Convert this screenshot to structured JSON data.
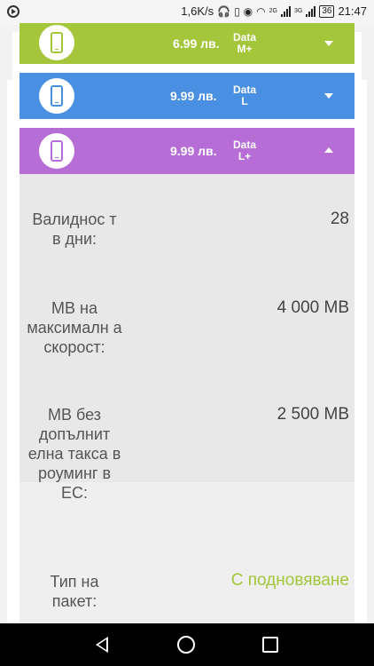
{
  "status_bar": {
    "speed": "1,6K/s",
    "net_1": "2G",
    "net_2": "3G",
    "battery": "36",
    "time": "21:47"
  },
  "cards": [
    {
      "price": "6.99 лв.",
      "plan_line1": "Data",
      "plan_line2": "M+",
      "color": "#a3c63a",
      "state": "collapsed"
    },
    {
      "price": "9.99 лв.",
      "plan_line1": "Data",
      "plan_line2": "L",
      "color": "#4a90e2",
      "state": "collapsed"
    },
    {
      "price": "9.99 лв.",
      "plan_line1": "Data",
      "plan_line2": "L+",
      "color": "#b66dd6",
      "state": "expanded"
    }
  ],
  "details": [
    {
      "label": "Валиднос т в дни:",
      "value": "28"
    },
    {
      "label": "MB на максималн а скорост:",
      "value": "4 000 MB"
    },
    {
      "label": "MB без допълнит елна такса в роуминг в ЕС:",
      "value": "2 500 MB"
    },
    {
      "label": "Тип на пакет:",
      "value": "С подновяване"
    }
  ],
  "colors": {
    "accent_green": "#a3c63a",
    "blue": "#4a90e2",
    "purple": "#b66dd6"
  }
}
